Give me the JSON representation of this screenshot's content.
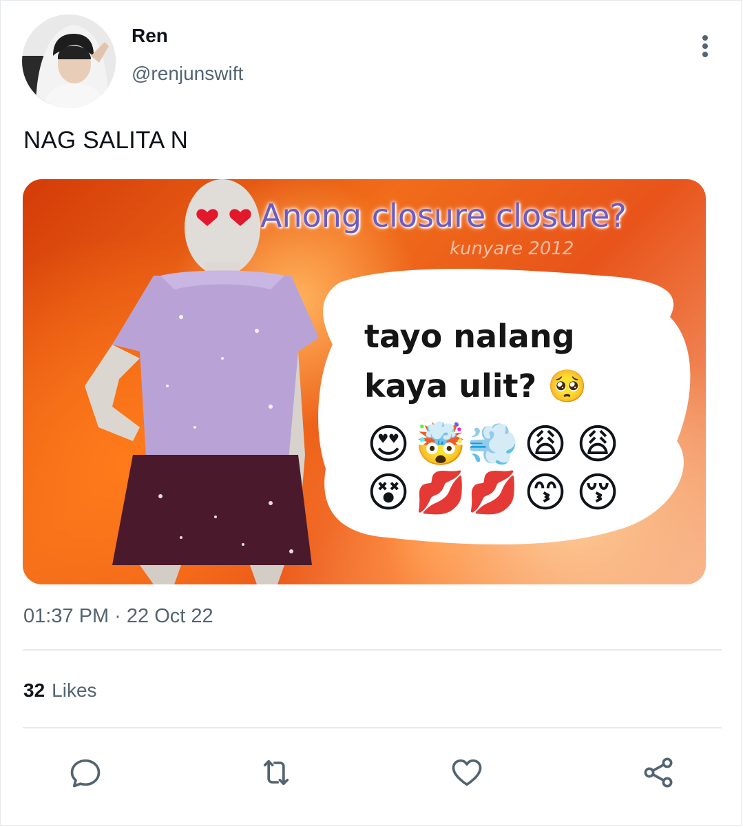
{
  "user": {
    "display_name": "Ren",
    "handle": "@renjunswift"
  },
  "tweet": {
    "text": "NAG SALITA N",
    "timestamp": "01:37 PM · 22 Oct 22"
  },
  "media": {
    "title": "Anong closure closure?",
    "watermark": "kunyare 2012",
    "caption_line1": "tayo nalang",
    "caption_line2": "kaya ulit?",
    "caption_emoji": "🥺",
    "emoji_row1": [
      "😍",
      "🤯",
      "💨",
      "😩",
      "😩"
    ],
    "emoji_row2": [
      "😵",
      "💋",
      "💋",
      "😙",
      "😚"
    ]
  },
  "stats": {
    "likes_count": "32",
    "likes_label": "Likes"
  },
  "icons": {
    "more": "more-vertical-icon",
    "reply": "reply-icon",
    "retweet": "retweet-icon",
    "like": "heart-icon",
    "share": "share-icon"
  },
  "colors": {
    "text_primary": "#0f1419",
    "text_secondary": "#536471",
    "divider": "#e6e9ec",
    "meme_title": "#6a5cc4"
  }
}
